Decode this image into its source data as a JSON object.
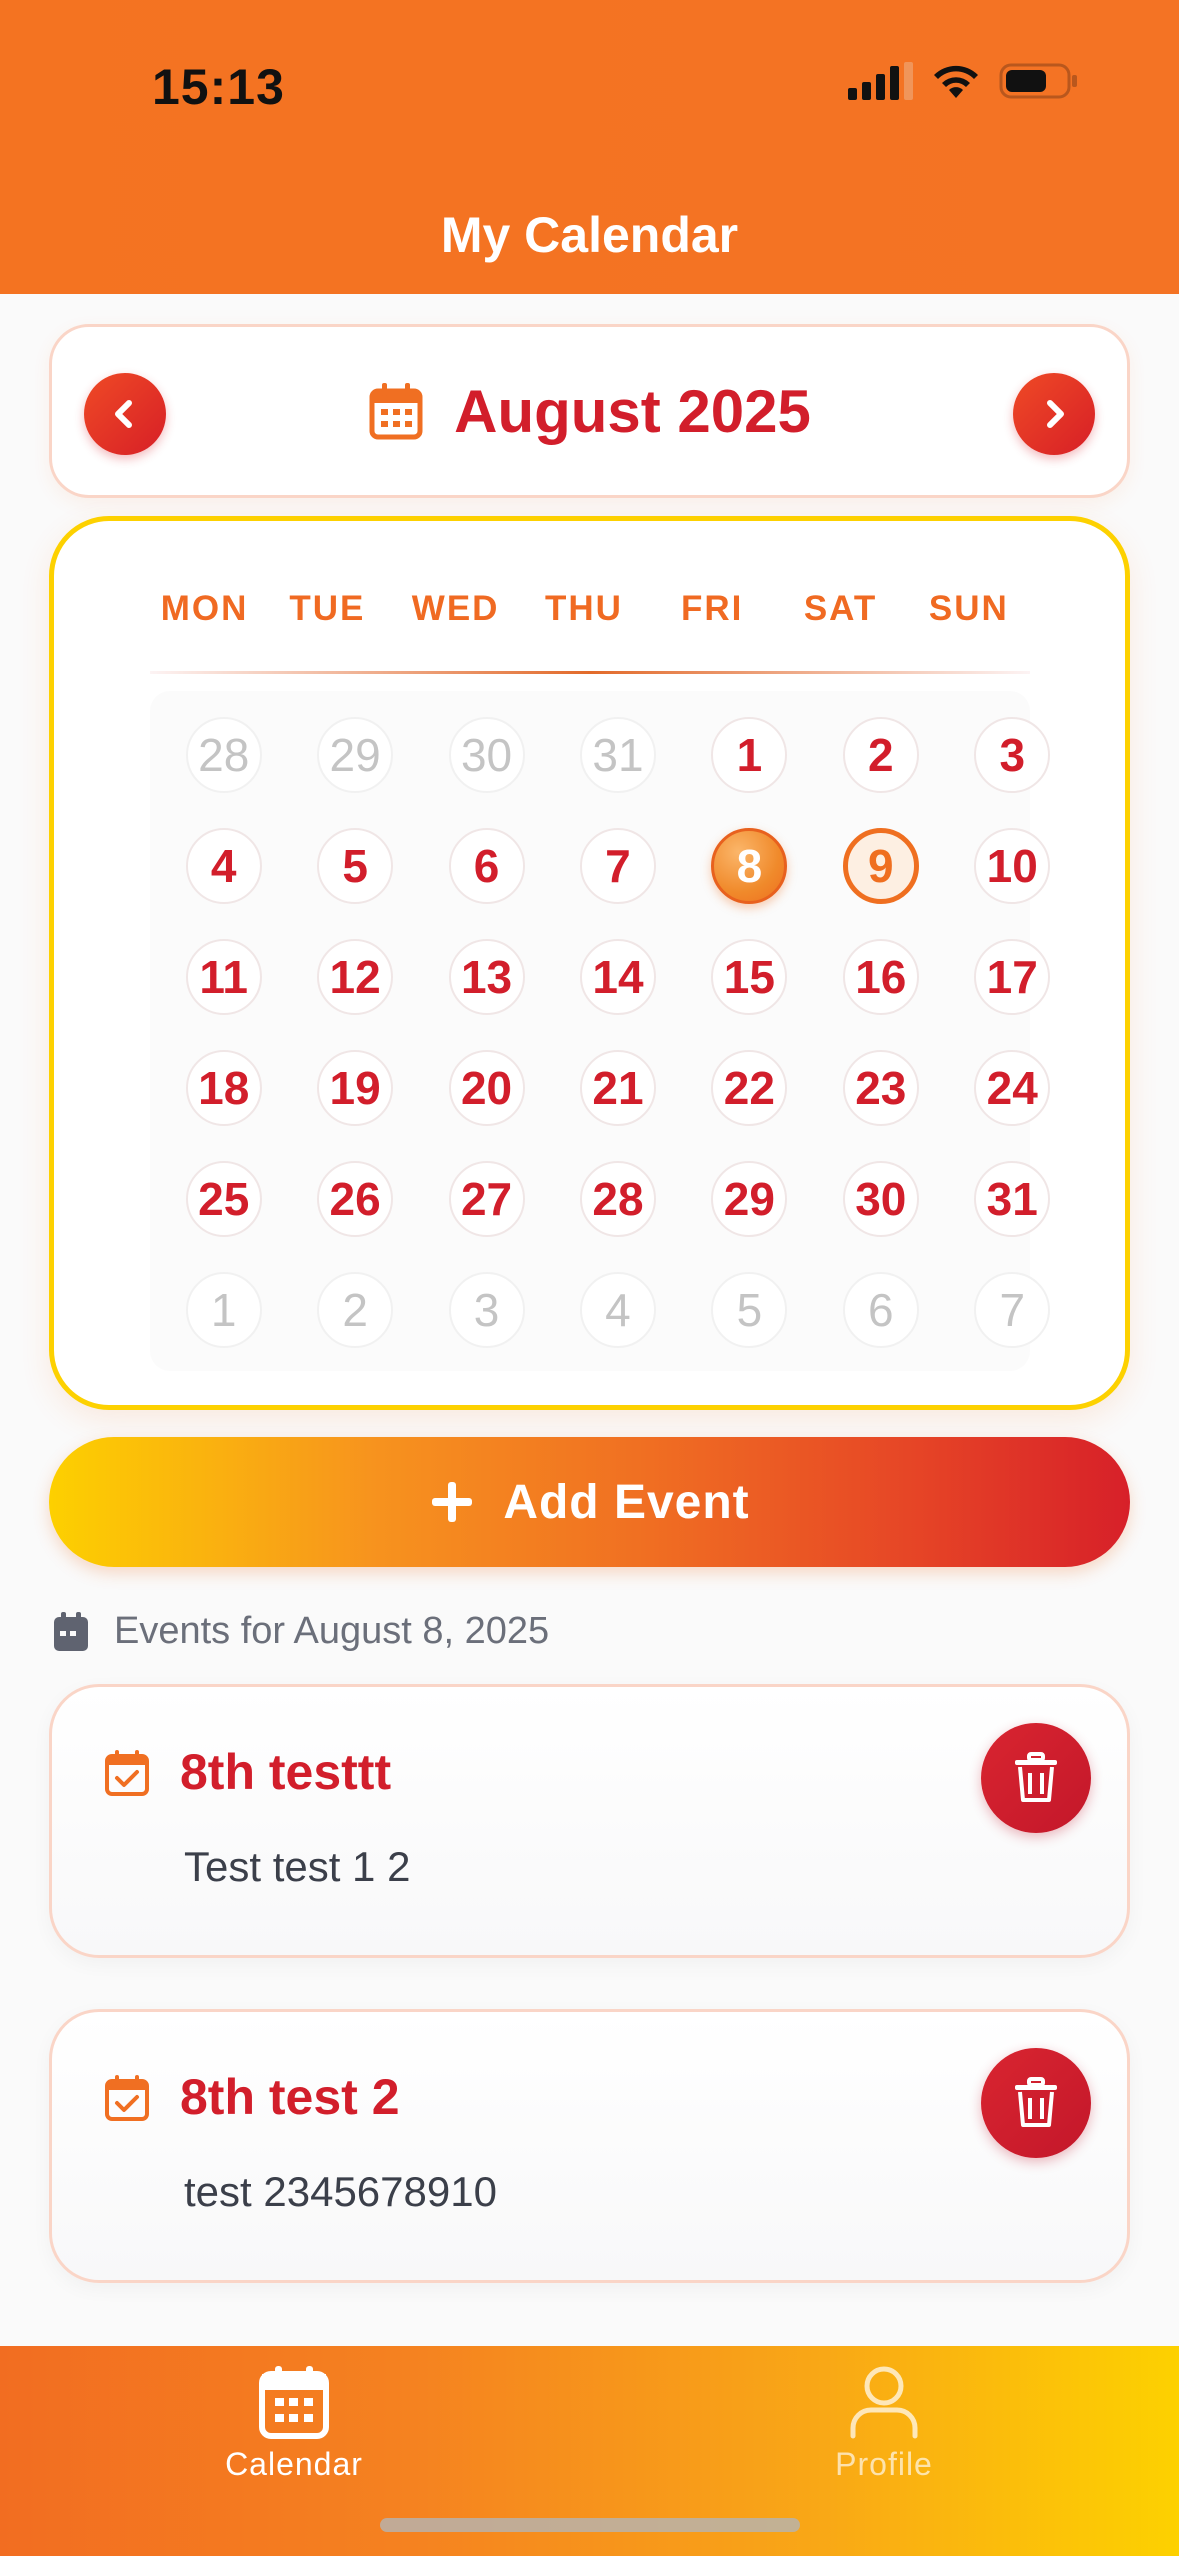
{
  "status_bar": {
    "time": "15:13"
  },
  "header": {
    "title": "My Calendar"
  },
  "month_nav": {
    "label": "August 2025",
    "icons": [
      "chevron-left-icon",
      "calendar-icon",
      "chevron-right-icon"
    ]
  },
  "calendar": {
    "weekdays": [
      "MON",
      "TUE",
      "WED",
      "THU",
      "FRI",
      "SAT",
      "SUN"
    ],
    "weeks": [
      [
        {
          "d": "28",
          "m": true
        },
        {
          "d": "29",
          "m": true
        },
        {
          "d": "30",
          "m": true
        },
        {
          "d": "31",
          "m": true
        },
        {
          "d": "1"
        },
        {
          "d": "2"
        },
        {
          "d": "3"
        }
      ],
      [
        {
          "d": "4"
        },
        {
          "d": "5"
        },
        {
          "d": "6"
        },
        {
          "d": "7"
        },
        {
          "d": "8",
          "s": "selected"
        },
        {
          "d": "9",
          "s": "today"
        },
        {
          "d": "10"
        }
      ],
      [
        {
          "d": "11"
        },
        {
          "d": "12"
        },
        {
          "d": "13"
        },
        {
          "d": "14"
        },
        {
          "d": "15"
        },
        {
          "d": "16"
        },
        {
          "d": "17"
        }
      ],
      [
        {
          "d": "18"
        },
        {
          "d": "19"
        },
        {
          "d": "20"
        },
        {
          "d": "21"
        },
        {
          "d": "22"
        },
        {
          "d": "23"
        },
        {
          "d": "24"
        }
      ],
      [
        {
          "d": "25"
        },
        {
          "d": "26"
        },
        {
          "d": "27"
        },
        {
          "d": "28"
        },
        {
          "d": "29"
        },
        {
          "d": "30"
        },
        {
          "d": "31"
        }
      ],
      [
        {
          "d": "1",
          "m": true
        },
        {
          "d": "2",
          "m": true
        },
        {
          "d": "3",
          "m": true
        },
        {
          "d": "4",
          "m": true
        },
        {
          "d": "5",
          "m": true
        },
        {
          "d": "6",
          "m": true
        },
        {
          "d": "7",
          "m": true
        }
      ]
    ]
  },
  "add_event": {
    "label": "Add Event"
  },
  "events": {
    "heading": "Events for August 8, 2025",
    "items": [
      {
        "title": "8th testtt",
        "description": "Test test 1 2"
      },
      {
        "title": "8th test 2",
        "description": "test 2345678910"
      }
    ]
  },
  "tabbar": {
    "tabs": [
      {
        "label": "Calendar",
        "active": true
      },
      {
        "label": "Profile",
        "active": false
      }
    ]
  },
  "colors": {
    "primary_orange": "#f47321",
    "accent_red": "#d21e2b",
    "accent_yellow": "#fdd100"
  }
}
